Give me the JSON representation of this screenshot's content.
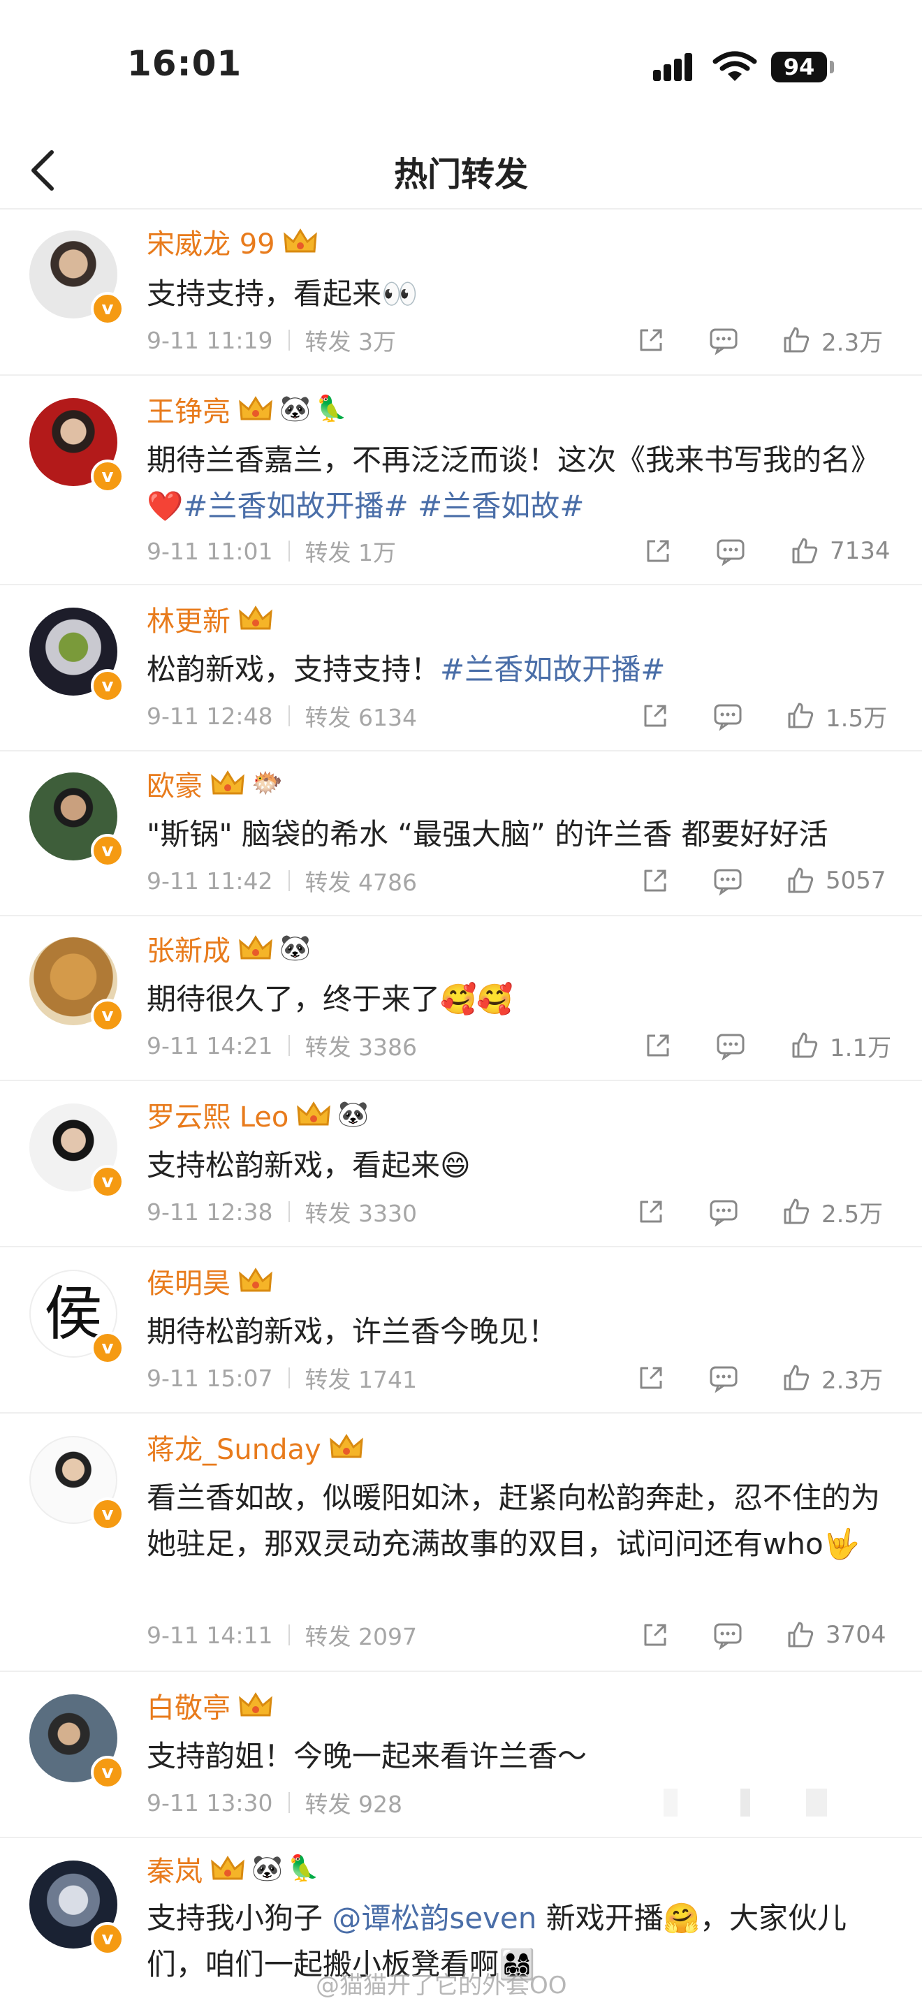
{
  "status_bar": {
    "time": "16:01",
    "battery": "94"
  },
  "nav": {
    "title": "热门转发"
  },
  "posts": [
    {
      "user": "宋威龙 99",
      "content": "支持支持，看起来👀",
      "time": "9-11 11:19",
      "repost": "转发 3万",
      "likes": "2.3万"
    },
    {
      "user": "王铮亮",
      "content_parts": [
        "期待兰香嘉兰，不再泛泛而谈！这次《我来书写我的名》❤️",
        "#兰香如故开播#",
        "#兰香如故#"
      ],
      "time": "9-11 11:01",
      "repost": "转发 1万",
      "likes": "7134"
    },
    {
      "user": "林更新",
      "content_parts": [
        "松韵新戏，支持支持！",
        "#兰香如故开播#"
      ],
      "time": "9-11 12:48",
      "repost": "转发 6134",
      "likes": "1.5万"
    },
    {
      "user": "欧豪",
      "content": "\"斯锅\" 脑袋的希水 “最强大脑” 的许兰香 都要好好活",
      "time": "9-11 11:42",
      "repost": "转发 4786",
      "likes": "5057"
    },
    {
      "user": "张新成",
      "content": "期待很久了，终于来了🥰🥰",
      "time": "9-11 14:21",
      "repost": "转发 3386",
      "likes": "1.1万"
    },
    {
      "user": "罗云熙 Leo",
      "content": "支持松韵新戏，看起来😄",
      "time": "9-11 12:38",
      "repost": "转发 3330",
      "likes": "2.5万"
    },
    {
      "user": "侯明昊",
      "avatar_char": "侯",
      "content": "期待松韵新戏，许兰香今晚见！",
      "time": "9-11 15:07",
      "repost": "转发 1741",
      "likes": "2.3万"
    },
    {
      "user": "蒋龙_Sunday",
      "content": "看兰香如故，似暖阳如沐，赶紧向松韵奔赴，忍不住的为她驻足，那双灵动充满故事的双目，试问问还有who🤟",
      "time": "9-11 14:11",
      "repost": "转发 2097",
      "likes": "3704"
    },
    {
      "user": "白敬亭",
      "content": "支持韵姐！今晚一起来看许兰香～",
      "time": "9-11 13:30",
      "repost": "转发 928"
    },
    {
      "user": "秦岚",
      "content_parts": [
        "支持我小狗子 ",
        "@谭松韵seven",
        " 新戏开播🤗，大家伙儿们，咱们一起搬小板凳看啊👨‍👩‍👧‍👦"
      ]
    }
  ],
  "watermark": "@猫猫开了它的外套OO",
  "colors": {
    "username": "#e87b1c",
    "hashtag": "#4a6ea8",
    "meta": "#a6a6a6",
    "verified": "#f59a12"
  },
  "icons": [
    "back-chevron-icon",
    "repost-icon",
    "comment-icon",
    "like-icon",
    "crown-icon",
    "verified-badge-icon"
  ]
}
